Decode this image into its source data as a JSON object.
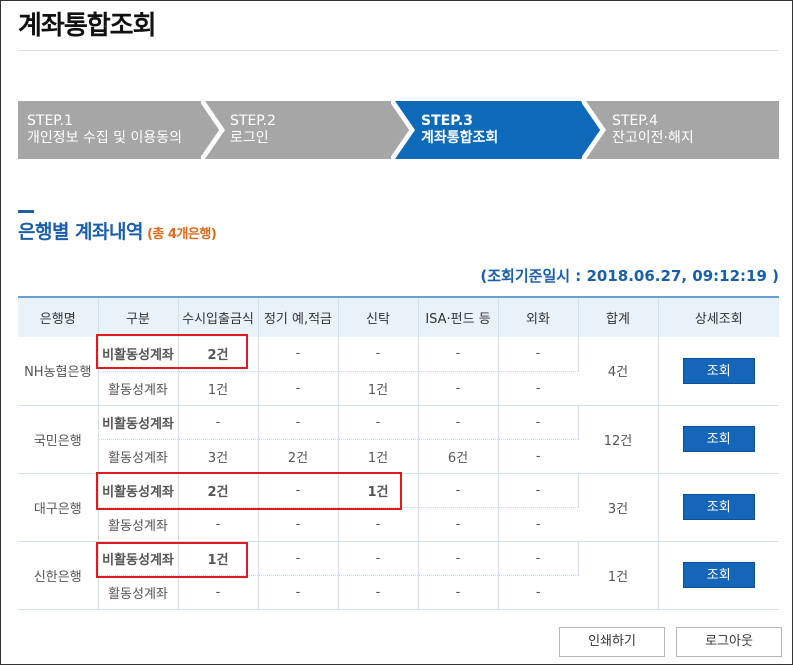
{
  "page": {
    "title": "계좌통합조회"
  },
  "steps": [
    {
      "label": "STEP.1",
      "sub": "개인정보 수집 및 이용동의",
      "active": false
    },
    {
      "label": "STEP.2",
      "sub": "로그인",
      "active": false
    },
    {
      "label": "STEP.3",
      "sub": "계좌통합조회",
      "active": true
    },
    {
      "label": "STEP.4",
      "sub": "잔고이전·해지",
      "active": false
    }
  ],
  "section": {
    "title": "은행별 계좌내역",
    "subtitle": "(총 4개은행)"
  },
  "timestamp": "(조회기준일시 : 2018.06.27, 09:12:19 )",
  "table": {
    "headers": [
      "은행명",
      "구분",
      "수시입출금식",
      "정기 예,적금",
      "신탁",
      "ISA·펀드 등",
      "외화",
      "합계",
      "상세조회"
    ],
    "banks": [
      {
        "name": "NH농협은행",
        "total": "4건",
        "button": "조회",
        "rows": [
          {
            "type": "비활동성계좌",
            "values": [
              "2건",
              "-",
              "-",
              "-",
              "-"
            ]
          },
          {
            "type": "활동성계좌",
            "values": [
              "1건",
              "-",
              "1건",
              "-",
              "-"
            ]
          }
        ]
      },
      {
        "name": "국민은행",
        "total": "12건",
        "button": "조회",
        "rows": [
          {
            "type": "비활동성계좌",
            "values": [
              "-",
              "-",
              "-",
              "-",
              "-"
            ]
          },
          {
            "type": "활동성계좌",
            "values": [
              "3건",
              "2건",
              "1건",
              "6건",
              "-"
            ]
          }
        ]
      },
      {
        "name": "대구은행",
        "total": "3건",
        "button": "조회",
        "rows": [
          {
            "type": "비활동성계좌",
            "values": [
              "2건",
              "-",
              "1건",
              "-",
              "-"
            ]
          },
          {
            "type": "활동성계좌",
            "values": [
              "-",
              "-",
              "-",
              "-",
              "-"
            ]
          }
        ]
      },
      {
        "name": "신한은행",
        "total": "1건",
        "button": "조회",
        "rows": [
          {
            "type": "비활동성계좌",
            "values": [
              "1건",
              "-",
              "-",
              "-",
              "-"
            ]
          },
          {
            "type": "활동성계좌",
            "values": [
              "-",
              "-",
              "-",
              "-",
              "-"
            ]
          }
        ]
      }
    ]
  },
  "buttons": {
    "print": "인쇄하기",
    "logout": "로그아웃"
  },
  "colors": {
    "step_inactive": "#a6a6a6",
    "step_active": "#0c6ab8",
    "accent": "#1a5fa8",
    "highlight": "#e0191f",
    "subtitle": "#d96a1e"
  }
}
